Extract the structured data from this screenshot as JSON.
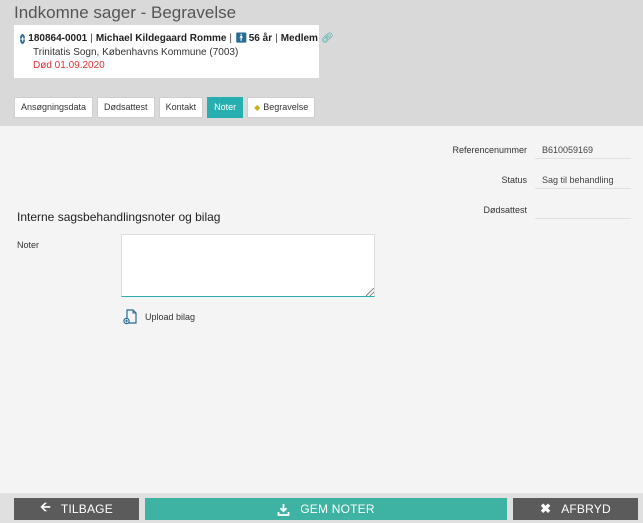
{
  "header": {
    "title": "Indkomne sager - Begravelse"
  },
  "person": {
    "id": "180864-0001",
    "name": "Michael Kildegaard Romme",
    "age": "56 år",
    "membership": "Medlem",
    "parish": "Trinitatis Sogn, Københavns Kommune (7003)",
    "death": "Død 01.09.2020",
    "icons": {
      "expand": "plus-circle-icon",
      "person": "person-icon",
      "link": "link-icon"
    },
    "colors": {
      "death": "#e53030",
      "accent": "#2a6b92"
    }
  },
  "tabs": [
    {
      "label": "Ansøgningsdata",
      "active": false
    },
    {
      "label": "Dødsattest",
      "active": false
    },
    {
      "label": "Kontakt",
      "active": false
    },
    {
      "label": "Noter",
      "active": true
    },
    {
      "label": "Begravelse",
      "active": false
    }
  ],
  "details": {
    "reference_label": "Referencenummer",
    "reference_value": "B610059169",
    "status_label": "Status",
    "status_value": "Sag til behandling",
    "certificate_label": "Dødsattest",
    "certificate_value": ""
  },
  "notes": {
    "section_title": "Interne sagsbehandlingsnoter og bilag",
    "label": "Noter",
    "value": "",
    "upload_label": "Upload bilag"
  },
  "footer": {
    "back_label": "TILBAGE",
    "save_label": "GEM NOTER",
    "cancel_label": "AFBRYD"
  },
  "theme": {
    "accent": "#27aeb0",
    "save": "#3fb3a3",
    "dark_button": "#5b5b5b"
  }
}
